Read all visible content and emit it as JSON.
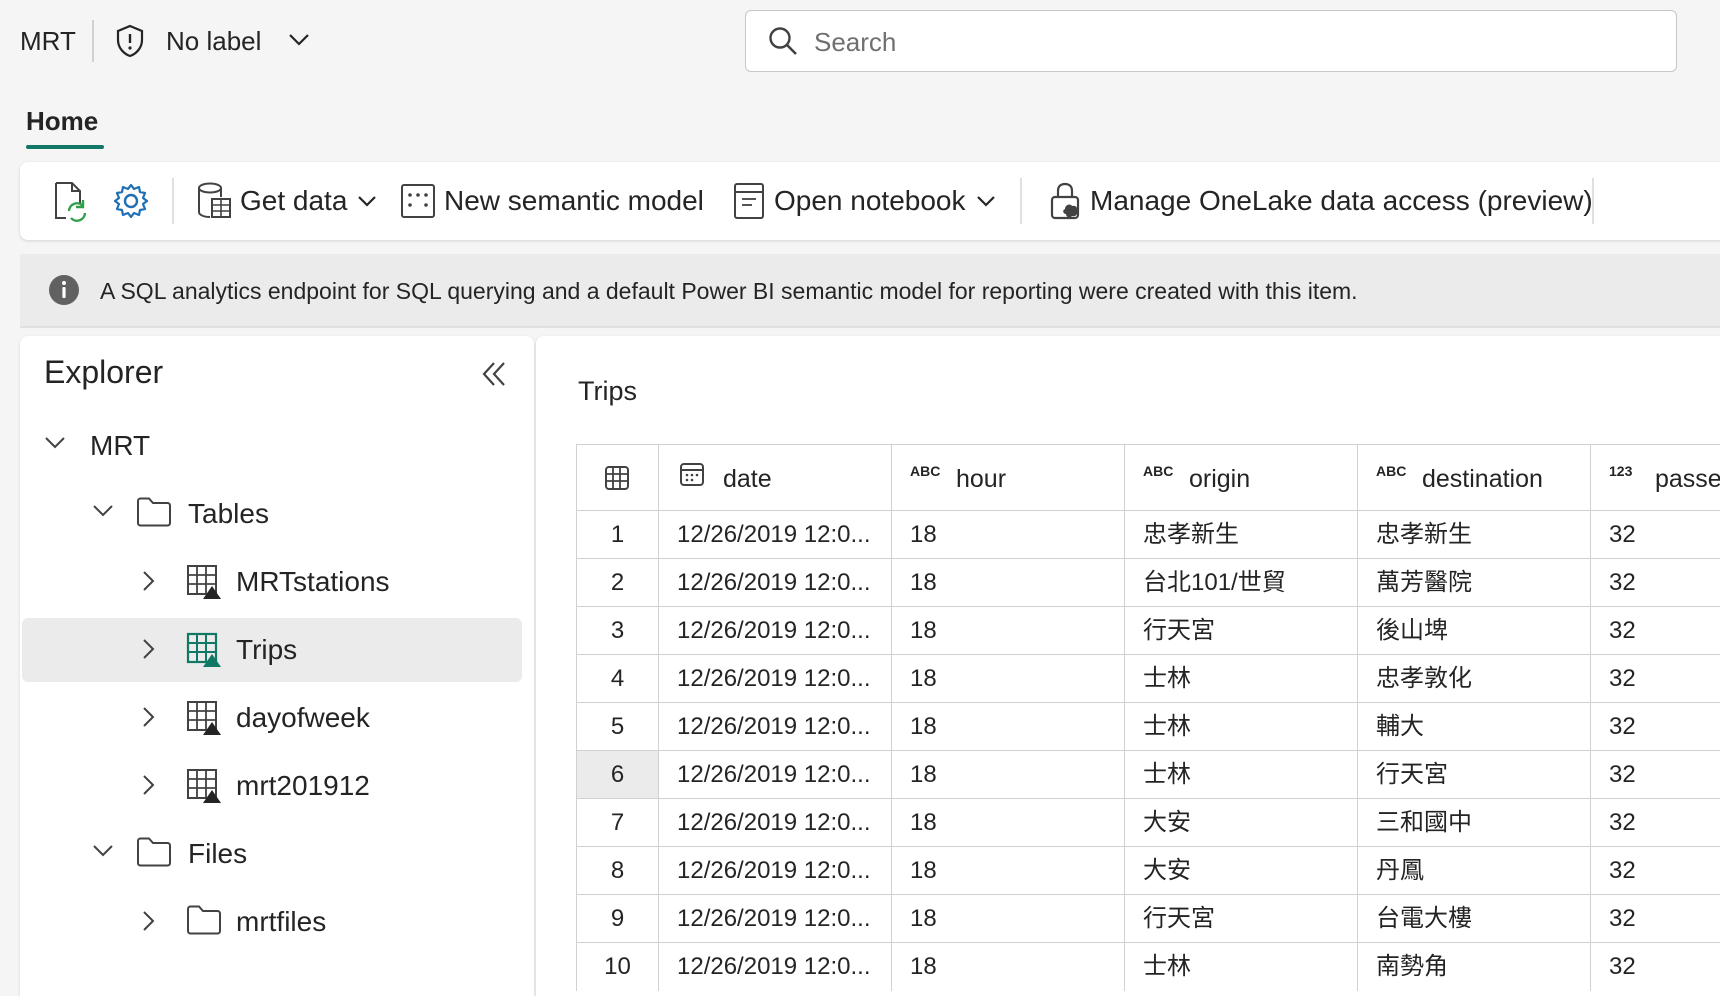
{
  "app": {
    "name": "MRT"
  },
  "sensitivity": {
    "label": "No label"
  },
  "search": {
    "placeholder": "Search"
  },
  "tabs": [
    {
      "label": "Home"
    }
  ],
  "ribbon": {
    "get_data": "Get data",
    "new_semantic_model": "New semantic model",
    "open_notebook": "Open notebook",
    "manage_onelake": "Manage OneLake data access (preview)"
  },
  "info_bar": {
    "message": "A SQL analytics endpoint for SQL querying and a default Power BI semantic model for reporting were created with this item."
  },
  "explorer": {
    "title": "Explorer",
    "tree": [
      {
        "label": "MRT",
        "icon": "none",
        "level": 0
      },
      {
        "label": "Tables",
        "icon": "folder-icon",
        "level": 1
      },
      {
        "label": "MRTstations",
        "icon": "delta-table-icon",
        "level": 2
      },
      {
        "label": "Trips",
        "icon": "delta-table-icon",
        "level": 2,
        "selected": true
      },
      {
        "label": "dayofweek",
        "icon": "delta-table-icon",
        "level": 2
      },
      {
        "label": "mrt201912",
        "icon": "delta-table-icon",
        "level": 2
      },
      {
        "label": "Files",
        "icon": "folder-icon",
        "level": 1
      },
      {
        "label": "mrtfiles",
        "icon": "folder-icon",
        "level": 2
      }
    ]
  },
  "table_view": {
    "title": "Trips",
    "columns": [
      {
        "name": "date",
        "type_icon": "calendar-icon"
      },
      {
        "name": "hour",
        "type_icon": "ABC"
      },
      {
        "name": "origin",
        "type_icon": "ABC"
      },
      {
        "name": "destination",
        "type_icon": "ABC"
      },
      {
        "name": "passe",
        "type_icon": "123"
      }
    ],
    "rows": [
      [
        "1",
        "12/26/2019 12:0...",
        "18",
        "忠孝新生",
        "忠孝新生",
        "32"
      ],
      [
        "2",
        "12/26/2019 12:0...",
        "18",
        "台北101/世貿",
        "萬芳醫院",
        "32"
      ],
      [
        "3",
        "12/26/2019 12:0...",
        "18",
        "行天宮",
        "後山埤",
        "32"
      ],
      [
        "4",
        "12/26/2019 12:0...",
        "18",
        "士林",
        "忠孝敦化",
        "32"
      ],
      [
        "5",
        "12/26/2019 12:0...",
        "18",
        "士林",
        "輔大",
        "32"
      ],
      [
        "6",
        "12/26/2019 12:0...",
        "18",
        "士林",
        "行天宮",
        "32"
      ],
      [
        "7",
        "12/26/2019 12:0...",
        "18",
        "大安",
        "三和國中",
        "32"
      ],
      [
        "8",
        "12/26/2019 12:0...",
        "18",
        "大安",
        "丹鳳",
        "32"
      ],
      [
        "9",
        "12/26/2019 12:0...",
        "18",
        "行天宮",
        "台電大樓",
        "32"
      ],
      [
        "10",
        "12/26/2019 12:0...",
        "18",
        "士林",
        "南勢角",
        "32"
      ]
    ]
  },
  "colors": {
    "accent": "#117865",
    "selected_row": "#ebebeb"
  }
}
